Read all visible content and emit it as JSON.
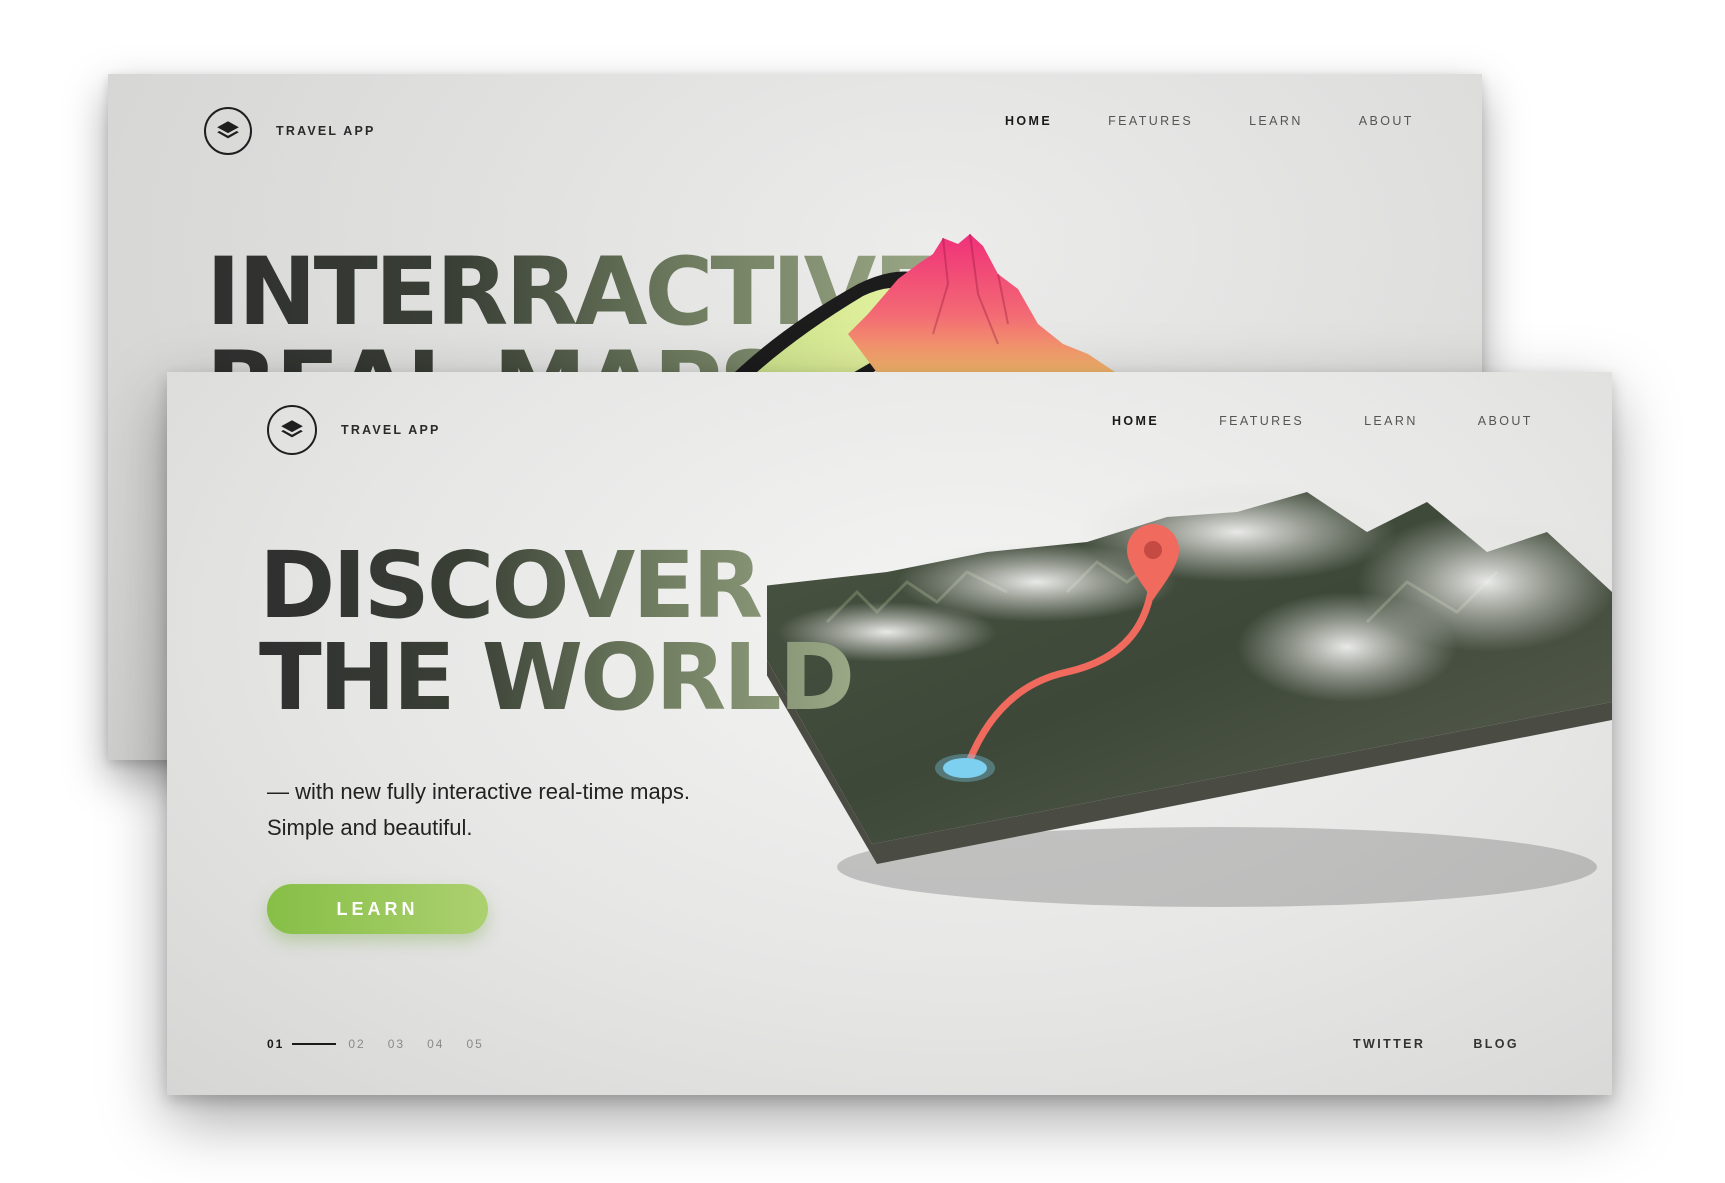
{
  "back_page": {
    "brand": {
      "name": "TRAVEL APP",
      "icon": "layers-icon"
    },
    "nav": [
      {
        "label": "HOME",
        "active": true
      },
      {
        "label": "FEATURES",
        "active": false
      },
      {
        "label": "LEARN",
        "active": false
      },
      {
        "label": "ABOUT",
        "active": false
      }
    ],
    "headline": {
      "line1": "INTERRACTIVE",
      "line2": "REAL MAPS"
    }
  },
  "front_page": {
    "brand": {
      "name": "TRAVEL APP",
      "icon": "layers-icon"
    },
    "nav": [
      {
        "label": "HOME",
        "active": true
      },
      {
        "label": "FEATURES",
        "active": false
      },
      {
        "label": "LEARN",
        "active": false
      },
      {
        "label": "ABOUT",
        "active": false
      }
    ],
    "headline": {
      "line1": "DISCOVER",
      "line2": "THE WORLD"
    },
    "subtitle": {
      "line1": "— with new fully interactive real-time maps.",
      "line2": "Simple and beautiful."
    },
    "cta_label": "LEARN",
    "pager": {
      "current": "01",
      "pages": [
        "02",
        "03",
        "04",
        "05"
      ]
    },
    "footer_links": [
      "TWITTER",
      "BLOG"
    ]
  },
  "colors": {
    "accent_green": "#8cc152",
    "route_red": "#f06a5e",
    "marker_blue": "#7fd0f0",
    "text_dark": "#1f1f1f"
  }
}
